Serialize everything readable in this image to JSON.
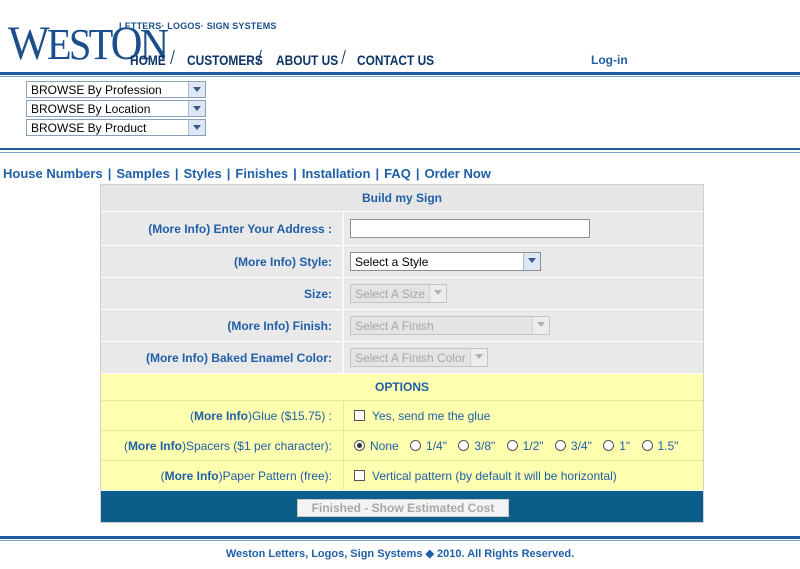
{
  "brand": {
    "logo": "WESTON",
    "logo_first": "W",
    "logo_mid": "EST",
    "logo_o": "O",
    "logo_end": "N",
    "tagline": "LETTERS· LOGOS· SIGN SYSTEMS"
  },
  "nav": {
    "home": "HOME",
    "customers": "CUSTOMERS",
    "about": "ABOUT US",
    "contact": "CONTACT US",
    "login": "Log-in"
  },
  "browse": [
    "BROWSE By Profession",
    "BROWSE By Location",
    "BROWSE By Product"
  ],
  "sublinks": [
    "House Numbers",
    "Samples",
    "Styles",
    "Finishes",
    "Installation",
    "FAQ",
    "Order Now"
  ],
  "form": {
    "title": "Build my Sign",
    "address_label": "(More Info) Enter Your Address :",
    "address_value": "",
    "style_label": "(More Info) Style:",
    "style_value": "Select a Style",
    "size_label": "Size:",
    "size_value": "Select A Size",
    "finish_label": "(More Info)  Finish:",
    "finish_value": "Select A Finish",
    "color_label": "(More Info) Baked Enamel Color:",
    "color_value": "Select A Finish Color",
    "options_title": "OPTIONS",
    "glue_more": "More Info",
    "glue_label_rest": " Glue ($15.75)  :",
    "glue_option": "Yes, send me the glue",
    "spacers_more": "More Info",
    "spacers_label_rest": " Spacers ($1 per character):",
    "spacer_options": [
      "None",
      "1/4\"",
      "3/8\"",
      "1/2\"",
      "3/4\"",
      "1\"",
      "1.5\""
    ],
    "pattern_more": "More Info",
    "pattern_label_rest": " Paper Pattern (free):",
    "pattern_option": "Vertical pattern (by default it will be horizontal)",
    "finish_button": "Finished - Show Estimated Cost"
  },
  "footer": {
    "copyright": "Weston Letters, Logos, Sign Systems ◆ 2010. All Rights Reserved."
  },
  "colors": {
    "brand_blue": "#1d5ca3",
    "link_blue": "#1f5fa8",
    "options_yellow": "#ffffb0",
    "bar_teal": "#0b5d8a"
  }
}
